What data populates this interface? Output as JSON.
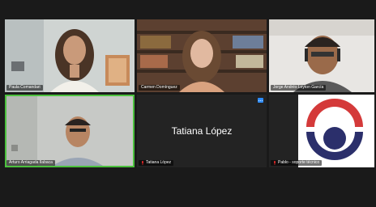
{
  "participants": [
    {
      "name": "Paula Comandari",
      "muted": false,
      "video": true
    },
    {
      "name": "Carmen Domínguez",
      "muted": false,
      "video": true
    },
    {
      "name": "Jorge Andrés Leyton García",
      "muted": false,
      "video": true
    },
    {
      "name": "Arturo Arriagada Ilabaca",
      "muted": false,
      "video": true,
      "active_speaker": true
    },
    {
      "name": "Tatiana López",
      "muted": true,
      "video": false,
      "center_label": "Tatiana López"
    },
    {
      "name": "Pablo - soporte técnico",
      "muted": true,
      "video": true
    }
  ],
  "colors": {
    "active_speaker_border": "#4cc13e",
    "muted_icon": "#e02828",
    "more_button": "#2d8cff",
    "logo_red": "#d43a3a",
    "logo_navy": "#2b2f6b"
  },
  "icons": [
    "muted-mic-icon",
    "more-options-icon",
    "logo-graphic"
  ]
}
